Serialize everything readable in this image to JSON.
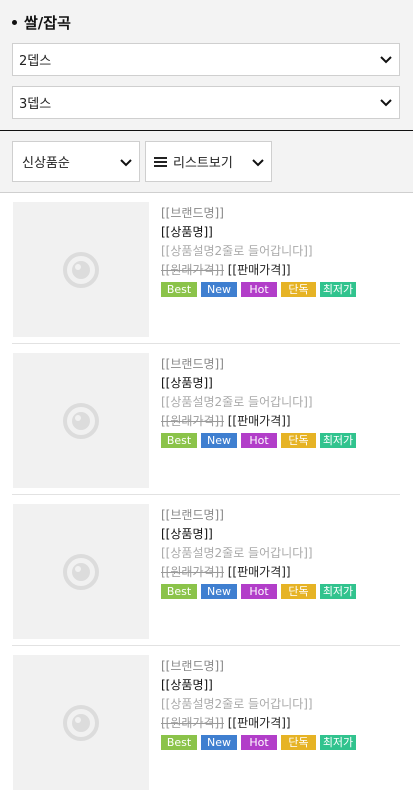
{
  "category": {
    "title": "쌀/잡곡"
  },
  "filters": {
    "depth2": "2뎁스",
    "depth3": "3뎁스"
  },
  "sortbar": {
    "sort_label": "신상품순",
    "view_label": "리스트보기"
  },
  "products": [
    {
      "brand": "[[브랜드명]]",
      "name": "[[상품명]]",
      "desc": "[[상품설명2줄로 들어갑니다]]",
      "orig_price": "[[원래가격]]",
      "sale_price": "[[판매가격]]",
      "badges": [
        "Best",
        "New",
        "Hot",
        "단독",
        "최저가"
      ]
    },
    {
      "brand": "[[브랜드명]]",
      "name": "[[상품명]]",
      "desc": "[[상품설명2줄로 들어갑니다]]",
      "orig_price": "[[원래가격]]",
      "sale_price": "[[판매가격]]",
      "badges": [
        "Best",
        "New",
        "Hot",
        "단독",
        "최저가"
      ]
    },
    {
      "brand": "[[브랜드명]]",
      "name": "[[상품명]]",
      "desc": "[[상품설명2줄로 들어갑니다]]",
      "orig_price": "[[원래가격]]",
      "sale_price": "[[판매가격]]",
      "badges": [
        "Best",
        "New",
        "Hot",
        "단독",
        "최저가"
      ]
    },
    {
      "brand": "[[브랜드명]]",
      "name": "[[상품명]]",
      "desc": "[[상품설명2줄로 들어갑니다]]",
      "orig_price": "[[원래가격]]",
      "sale_price": "[[판매가격]]",
      "badges": [
        "Best",
        "New",
        "Hot",
        "단독",
        "최저가"
      ]
    }
  ],
  "colors": {
    "best": "#8bc34a",
    "new": "#3f7fd0",
    "hot": "#b23ec9",
    "exclusive": "#e6b325",
    "lowest": "#31c38e"
  },
  "icons": {
    "dropdown": "chevron-down-icon",
    "list": "list-view-icon",
    "placeholder": "image-placeholder-icon"
  }
}
